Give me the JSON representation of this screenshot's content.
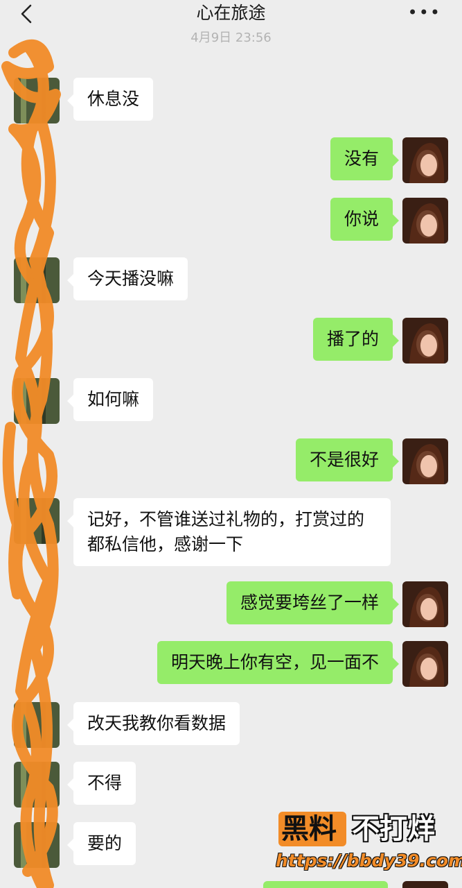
{
  "header": {
    "title": "心在旅途",
    "more_icon": "more-dots-icon",
    "back_icon": "chevron-left-icon"
  },
  "timestamp": "4月9日 23:56",
  "colors": {
    "background": "#ededed",
    "incoming_bubble": "#ffffff",
    "outgoing_bubble": "#95ec69",
    "scribble": "#f28c28"
  },
  "messages": [
    {
      "from": "contact",
      "text": "休息没"
    },
    {
      "from": "self",
      "text": "没有"
    },
    {
      "from": "self",
      "text": "你说"
    },
    {
      "from": "contact",
      "text": "今天播没嘛"
    },
    {
      "from": "self",
      "text": "播了的"
    },
    {
      "from": "contact",
      "text": "如何嘛"
    },
    {
      "from": "self",
      "text": "不是很好"
    },
    {
      "from": "contact",
      "text": "记好，不管谁送过礼物的，打赏过的都私信他，感谢一下"
    },
    {
      "from": "self",
      "text": "感觉要垮丝了一样"
    },
    {
      "from": "self",
      "text": "明天晚上你有空，见一面不"
    },
    {
      "from": "contact",
      "text": "改天我教你看数据"
    },
    {
      "from": "contact",
      "text": "不得"
    },
    {
      "from": "contact",
      "text": "要的"
    }
  ],
  "watermark": {
    "brand": "黑料",
    "slogan": "不打烊",
    "url": "https://bbdy39.com"
  }
}
